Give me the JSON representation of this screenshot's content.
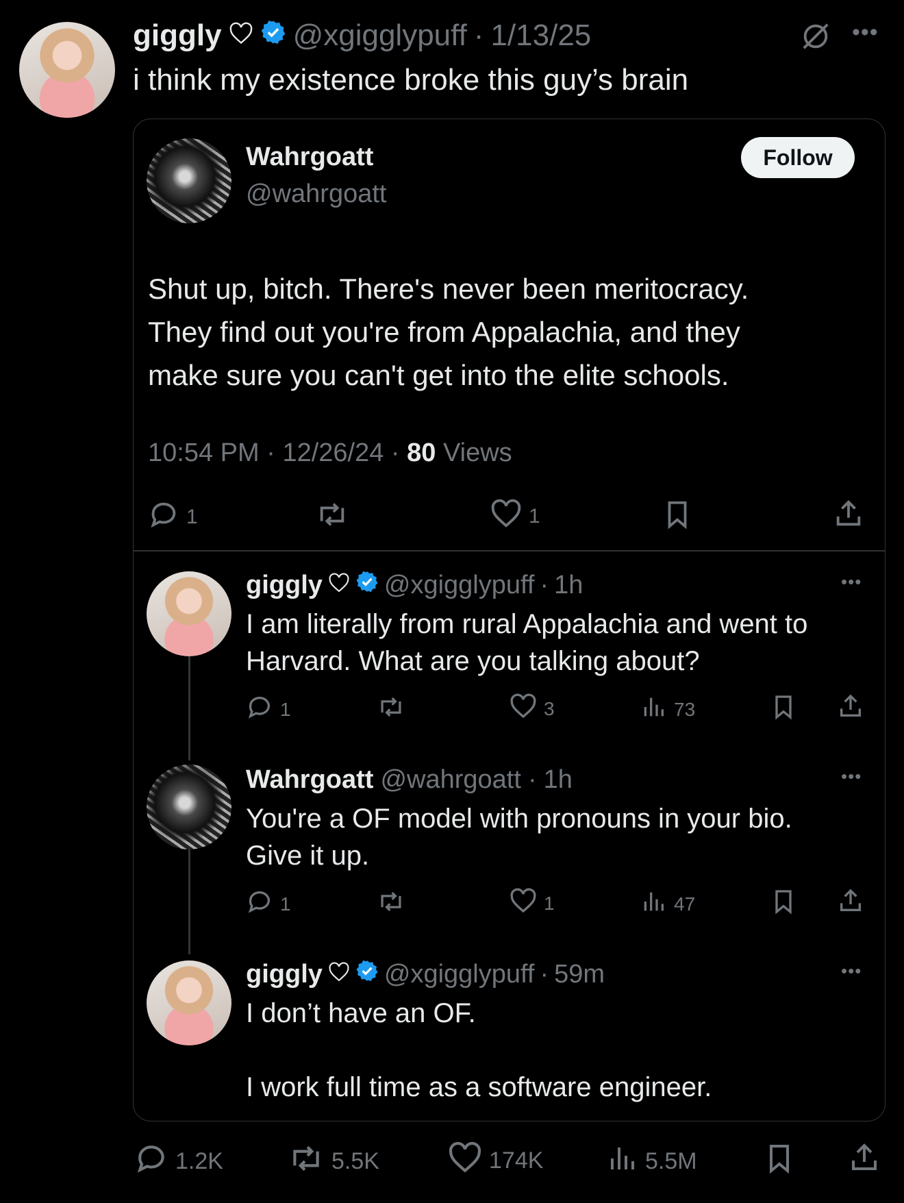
{
  "main_tweet": {
    "author_name": "giggly",
    "author_handle": "@xgigglypuff",
    "date": "1/13/25",
    "text": "i think my existence broke this guy’s brain",
    "stats": {
      "replies": "1.2K",
      "reposts": "5.5K",
      "likes": "174K",
      "views": "5.5M"
    }
  },
  "quoted": {
    "author_name": "Wahrgoatt",
    "author_handle": "@wahrgoatt",
    "follow_label": "Follow",
    "text_lines": [
      "Shut up, bitch. There's never been meritocracy.",
      "They find out you're from Appalachia, and they",
      "make sure you can't get into the elite schools."
    ],
    "time": "10:54 PM",
    "date": "12/26/24",
    "views_count": "80",
    "views_label": "Views",
    "stats": {
      "replies": "1",
      "likes": "1"
    }
  },
  "replies": [
    {
      "author_name": "giggly",
      "author_handle": "@xgigglypuff",
      "age": "1h",
      "lines": [
        "I am literally from rural Appalachia and went to",
        "Harvard. What are you talking about?"
      ],
      "stats": {
        "replies": "1",
        "likes": "3",
        "views": "73"
      }
    },
    {
      "author_name": "Wahrgoatt",
      "author_handle": "@wahrgoatt",
      "age": "1h",
      "lines": [
        "You're a OF model with pronouns in your bio.",
        "Give it up."
      ],
      "stats": {
        "replies": "1",
        "likes": "1",
        "views": "47"
      }
    },
    {
      "author_name": "giggly",
      "author_handle": "@xgigglypuff",
      "age": "59m",
      "lines": [
        "I don’t have an OF.",
        "I work full time as a software engineer."
      ]
    }
  ],
  "colors": {
    "background": "#000000",
    "text": "#e7e9ea",
    "muted": "#71767b",
    "verified": "#1d9bf0",
    "border": "#2f3336"
  },
  "icons": [
    "reply-icon",
    "repost-icon",
    "like-icon",
    "bookmark-icon",
    "share-icon",
    "views-icon",
    "more-icon",
    "grok-icon",
    "verified-icon"
  ]
}
